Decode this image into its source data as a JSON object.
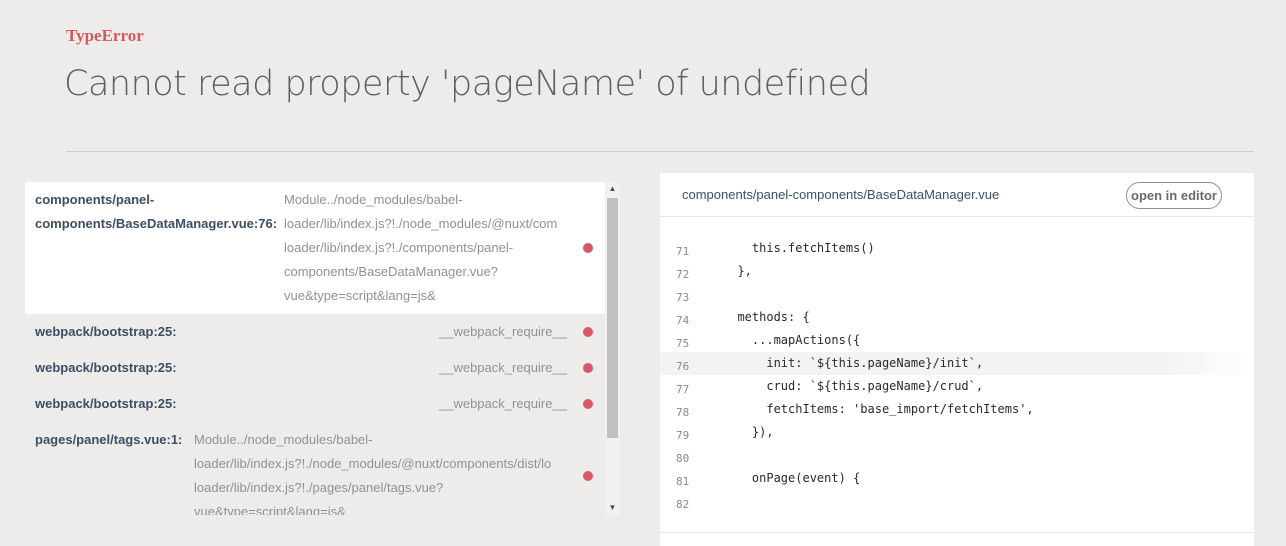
{
  "error": {
    "type": "TypeError",
    "message": "Cannot read property 'pageName' of undefined"
  },
  "stack": [
    {
      "file": "components/panel-components/BaseDataManager.vue:76:",
      "fn": "Module../node_modules/babel-loader/lib/index.js?!./node_modules/@nuxt/components/dist/loader.js?!./node_modules/vue-loader/lib/index.js?!./components/panel-components/BaseDataManager.vue?vue&type=script&lang=js&",
      "fn_lines": [
        "Module../node_modules/babel-",
        "loader/lib/index.js?!./node_modules/@nuxt/com",
        "loader/lib/index.js?!./components/panel-",
        "components/BaseDataManager.vue?",
        "vue&type=script&lang=js&"
      ],
      "file_lines": [
        "components/panel-",
        "components/BaseDataManager.vue:76:"
      ],
      "active": true
    },
    {
      "file": "webpack/bootstrap:25:",
      "fn": "__webpack_require__",
      "active": false
    },
    {
      "file": "webpack/bootstrap:25:",
      "fn": "__webpack_require__",
      "active": false
    },
    {
      "file": "webpack/bootstrap:25:",
      "fn": "__webpack_require__",
      "active": false
    },
    {
      "file": "pages/panel/tags.vue:1:",
      "fn_lines": [
        "Module../node_modules/babel-",
        "loader/lib/index.js?!./node_modules/@nuxt/components/dist/lo",
        "loader/lib/index.js?!./pages/panel/tags.vue?",
        "vue&type=script&lang=js&"
      ],
      "active": false
    }
  ],
  "code": {
    "filename": "components/panel-components/BaseDataManager.vue",
    "open_label": "open in editor",
    "lines": [
      {
        "n": "71",
        "text": "    this.fetchItems()",
        "hl": false
      },
      {
        "n": "72",
        "text": "  },",
        "hl": false
      },
      {
        "n": "73",
        "text": "",
        "hl": false
      },
      {
        "n": "74",
        "text": "  methods: {",
        "hl": false
      },
      {
        "n": "75",
        "text": "    ...mapActions({",
        "hl": false
      },
      {
        "n": "76",
        "text": "      init: `${this.pageName}/init`,",
        "hl": true
      },
      {
        "n": "77",
        "text": "      crud: `${this.pageName}/crud`,",
        "hl": false
      },
      {
        "n": "78",
        "text": "      fetchItems: 'base_import/fetchItems',",
        "hl": false
      },
      {
        "n": "79",
        "text": "    }),",
        "hl": false
      },
      {
        "n": "80",
        "text": "",
        "hl": false
      },
      {
        "n": "81",
        "text": "    onPage(event) {",
        "hl": false
      },
      {
        "n": "82",
        "text": "",
        "hl": false
      }
    ]
  },
  "colors": {
    "accent_red": "#d45a5a",
    "dot": "#d9576a",
    "background": "#edecea"
  }
}
